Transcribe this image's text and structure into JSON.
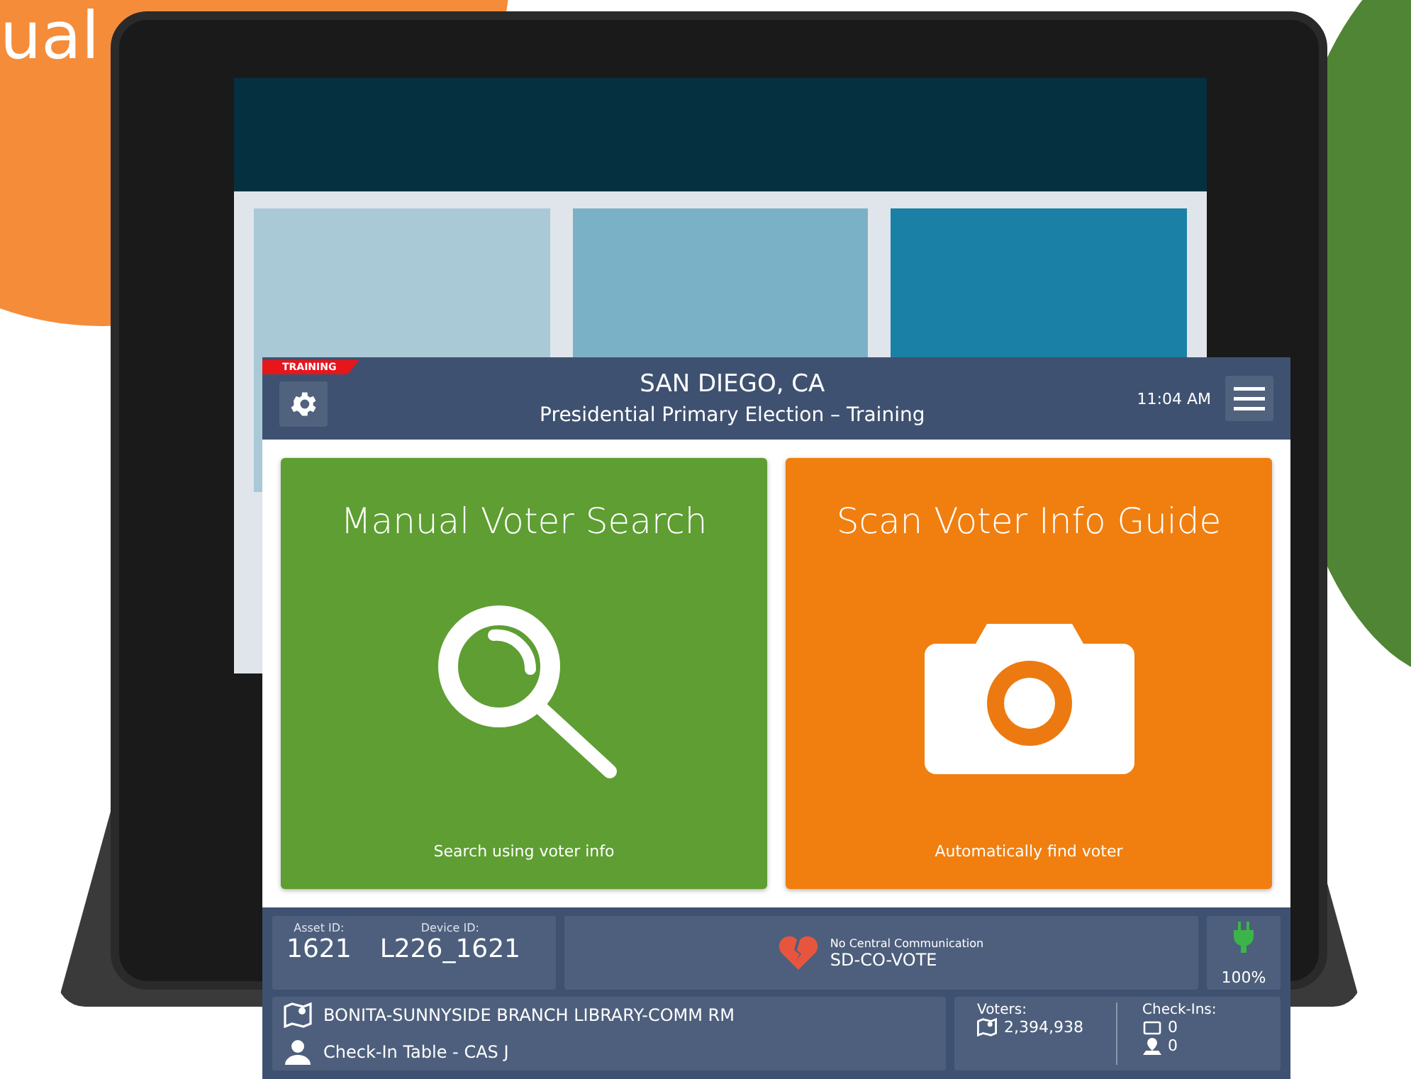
{
  "backdrop": {
    "heading_fragment": "ual"
  },
  "header": {
    "badge": "TRAINING",
    "title": "SAN DIEGO, CA",
    "subtitle": "Presidential Primary Election – Training",
    "time": "11:04 AM"
  },
  "tiles": [
    {
      "kind": "search",
      "title": "Manual Voter Search",
      "caption": "Search using voter info",
      "color": "#5e9e32"
    },
    {
      "kind": "camera",
      "title": "Scan Voter Info Guide",
      "caption": "Automatically find voter",
      "color": "#f07f10"
    }
  ],
  "device": {
    "asset_label": "Asset ID:",
    "asset_value": "1621",
    "device_label": "Device ID:",
    "device_value": "L226_1621"
  },
  "communication": {
    "status": "No Central Communication",
    "server": "SD-CO-VOTE"
  },
  "power": {
    "reading": "100%"
  },
  "site": {
    "location": "BONITA-SUNNYSIDE BRANCH LIBRARY-COMM RM",
    "table": "Check-In Table - CAS J"
  },
  "voters": {
    "label": "Voters:",
    "count": "2,394,938"
  },
  "checkins": {
    "label": "Check-Ins:",
    "device_count": "0",
    "site_count": "0"
  }
}
